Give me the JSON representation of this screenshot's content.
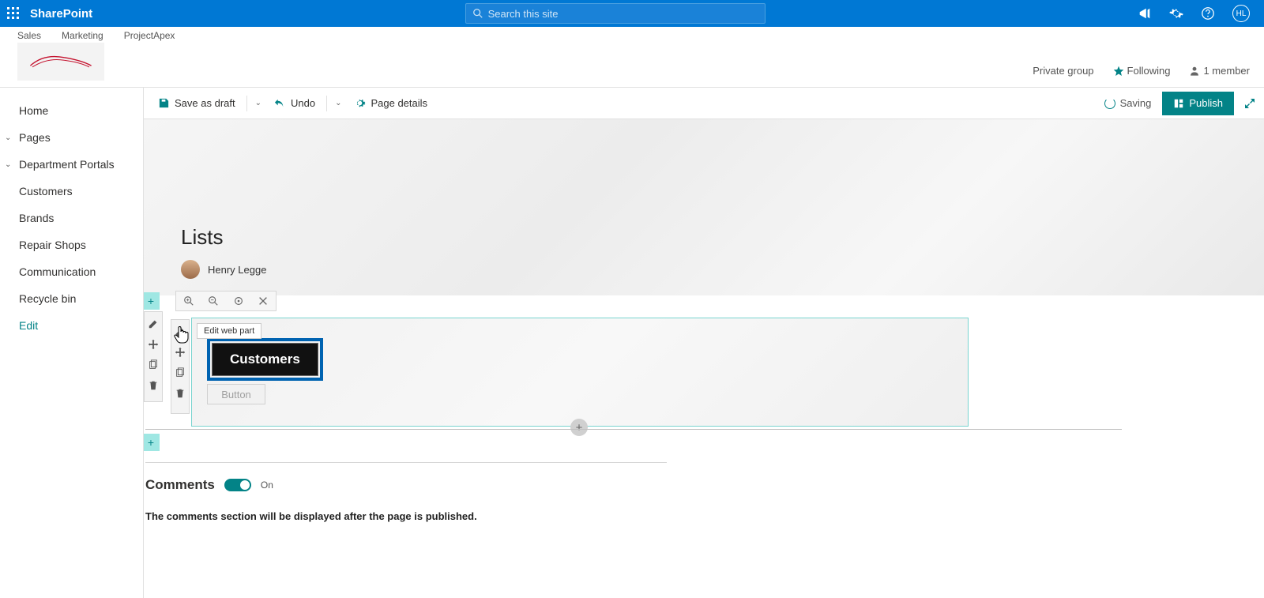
{
  "brand": "SharePoint",
  "search": {
    "placeholder": "Search this site"
  },
  "avatar_initials": "HL",
  "hubnav": {
    "items": [
      "Sales",
      "Marketing",
      "ProjectApex"
    ]
  },
  "site_meta": {
    "group_type": "Private group",
    "following": "Following",
    "members": "1 member"
  },
  "leftnav": {
    "home": "Home",
    "pages": "Pages",
    "dept": "Department Portals",
    "customers": "Customers",
    "brands": "Brands",
    "repair": "Repair Shops",
    "communication": "Communication",
    "recycle": "Recycle bin",
    "edit": "Edit"
  },
  "commands": {
    "save_draft": "Save as draft",
    "undo": "Undo",
    "page_details": "Page details",
    "saving": "Saving",
    "publish": "Publish"
  },
  "page": {
    "title": "Lists",
    "author": "Henry Legge"
  },
  "tooltip": "Edit web part",
  "webpart": {
    "button_primary": "Customers",
    "button_placeholder": "Button"
  },
  "comments": {
    "heading": "Comments",
    "state": "On",
    "note": "The comments section will be displayed after the page is published."
  }
}
